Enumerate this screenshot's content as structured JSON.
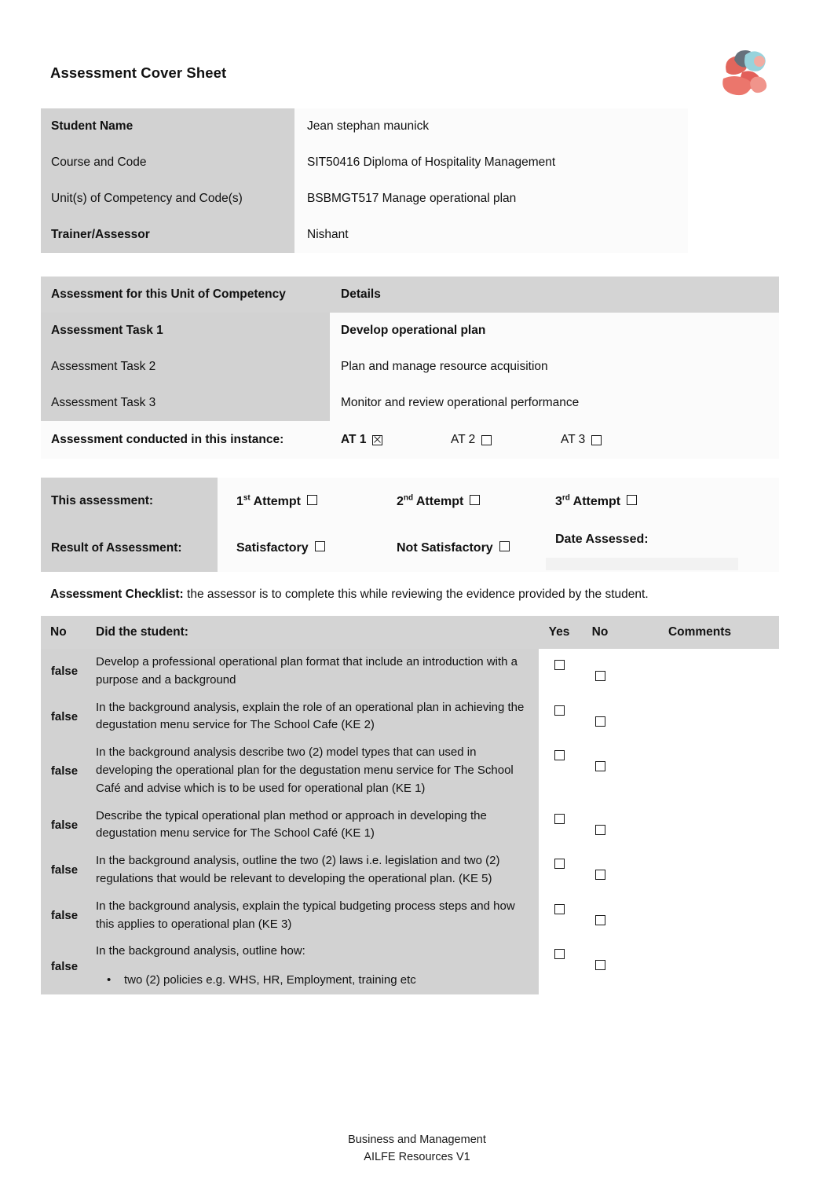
{
  "document": {
    "title": "Assessment Cover Sheet",
    "logo": "organisation-logo"
  },
  "student_info": {
    "rows": [
      {
        "label": "Student Name",
        "value": "Jean stephan maunick",
        "bold": true
      },
      {
        "label": "Course and Code",
        "value": "SIT50416 Diploma of Hospitality Management",
        "bold": false
      },
      {
        "label": "Unit(s) of Competency and Code(s)",
        "value": "BSBMGT517 Manage operational plan",
        "bold": false
      },
      {
        "label": "Trainer/Assessor",
        "value": "Nishant",
        "bold": true
      }
    ]
  },
  "assessment_tasks": {
    "header": {
      "left": "Assessment for this Unit of Competency",
      "right": "Details"
    },
    "rows": [
      {
        "label": "Assessment Task 1",
        "detail": "Develop operational plan"
      },
      {
        "label": "Assessment Task 2",
        "detail": "Plan and manage resource acquisition"
      },
      {
        "label": "Assessment Task 3",
        "detail": "Monitor and review operational performance"
      }
    ],
    "instance_label": "Assessment conducted in this instance:",
    "instances": [
      {
        "label": "AT 1",
        "checked": true
      },
      {
        "label": "AT 2",
        "checked": false
      },
      {
        "label": "AT 3",
        "checked": false
      }
    ]
  },
  "assessment_result": {
    "this_assessment_label": "This assessment:",
    "attempt_1": "1st Attempt",
    "attempt_1_ord": "st",
    "attempt_2": "2nd Attempt",
    "attempt_2_ord": "nd",
    "attempt_3": "3rd Attempt",
    "attempt_3_ord": "rd",
    "result_label": "Result of Assessment:",
    "satisfactory": "Satisfactory",
    "not_satisfactory": "Not Satisfactory",
    "date_assessed_label": "Date Assessed:",
    "date_assessed_value": ""
  },
  "checklist": {
    "intro_bold": "Assessment Checklist:",
    "intro_rest": " the assessor is to complete this while reviewing the evidence provided by the student.",
    "columns": {
      "no": "No",
      "task": "Did the student:",
      "yes": "Yes",
      "no_col": "No",
      "comments": "Comments"
    },
    "rows": [
      {
        "no": false,
        "text": "Develop  a professional operational plan format that include an introduction with a purpose and a background",
        "bullet": "",
        "yes": false,
        "comment": ""
      },
      {
        "no": false,
        "text": "In the background analysis, explain the role of an operational plan in achieving the degustation menu service for The School Cafe (KE 2)",
        "bullet": "",
        "yes": false,
        "comment": ""
      },
      {
        "no": false,
        "text": "In the background analysis describe two (2) model types that can used in developing the operational plan for the degustation menu service for The School Café and advise which is to be used for operational plan (KE 1)",
        "bullet": "",
        "yes": false,
        "comment": ""
      },
      {
        "no": false,
        "text": "Describe the typical operational plan method or approach in developing the degustation menu service for The School Café (KE 1)",
        "bullet": "",
        "yes": false,
        "comment": ""
      },
      {
        "no": false,
        "text": "In the background analysis, outline the two (2) laws i.e. legislation and two (2) regulations that would be relevant to developing the operational plan. (KE 5)",
        "bullet": "",
        "yes": false,
        "comment": ""
      },
      {
        "no": false,
        "text": "In the background analysis, explain the typical budgeting process steps and how this applies to operational plan (KE 3)",
        "bullet": "",
        "yes": false,
        "comment": ""
      },
      {
        "no": false,
        "text": "In the background analysis, outline how:",
        "bullet": "two (2) policies e.g. WHS, HR, Employment, training etc",
        "yes": false,
        "comment": ""
      }
    ]
  },
  "footer": {
    "line1": "Business and Management",
    "line2": "AILFE Resources V1"
  }
}
